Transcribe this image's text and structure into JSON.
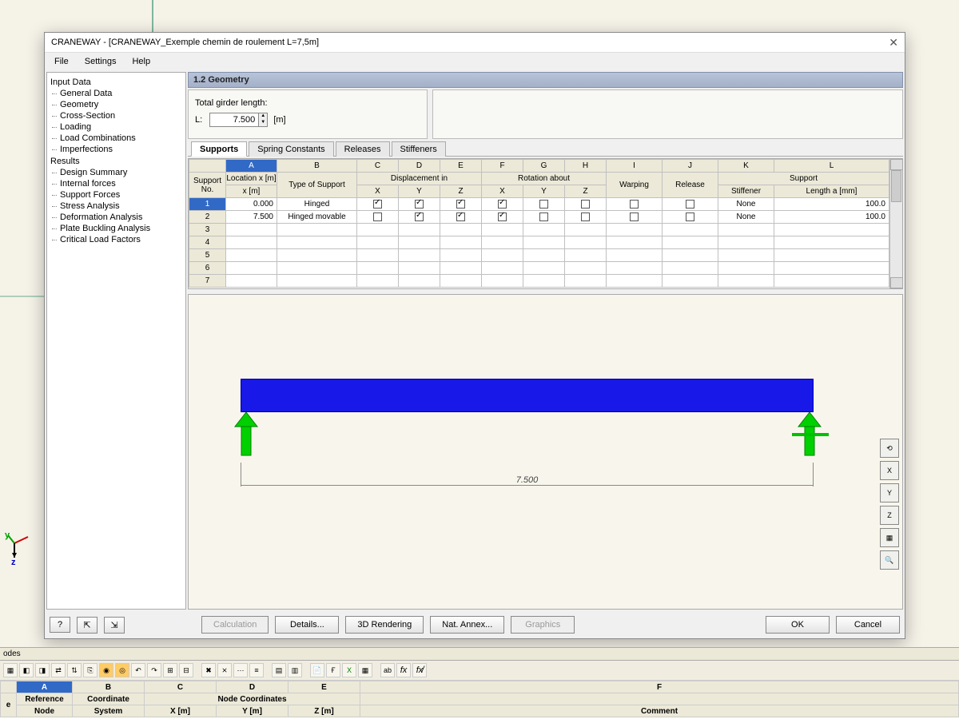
{
  "window": {
    "title": "CRANEWAY - [CRANEWAY_Exemple chemin de roulement L=7,5m]"
  },
  "menu": {
    "file": "File",
    "settings": "Settings",
    "help": "Help"
  },
  "tree": {
    "input": "Input Data",
    "input_items": [
      "General Data",
      "Geometry",
      "Cross-Section",
      "Loading",
      "Load Combinations",
      "Imperfections"
    ],
    "results": "Results",
    "results_items": [
      "Design Summary",
      "Internal forces",
      "Support Forces",
      "Stress Analysis",
      "Deformation Analysis",
      "Plate Buckling Analysis",
      "Critical Load Factors"
    ]
  },
  "section": {
    "title": "1.2 Geometry"
  },
  "params": {
    "girder_label": "Total girder length:",
    "L_label": "L:",
    "L_value": "7.500",
    "L_unit": "[m]"
  },
  "tabs": {
    "supports": "Supports",
    "spring": "Spring Constants",
    "releases": "Releases",
    "stiffeners": "Stiffeners"
  },
  "grid": {
    "letters": [
      "A",
      "B",
      "C",
      "D",
      "E",
      "F",
      "G",
      "H",
      "I",
      "J",
      "K",
      "L"
    ],
    "group1": "Support No.",
    "col_loc": "Location x [m]",
    "col_type": "Type of Support",
    "grp_disp": "Displacement in",
    "grp_rot": "Rotation about",
    "grp_support": "Support",
    "xyz": [
      "X",
      "Y",
      "Z"
    ],
    "warping": "Warping",
    "release": "Release",
    "stiffener": "Stiffener",
    "length": "Length a [mm]",
    "rows": [
      {
        "no": "1",
        "loc": "0.000",
        "type": "Hinged",
        "dx": true,
        "dy": true,
        "dz": true,
        "rx": true,
        "ry": false,
        "rz": false,
        "warp": false,
        "rel": false,
        "stiff": "None",
        "len": "100.0"
      },
      {
        "no": "2",
        "loc": "7.500",
        "type": "Hinged movable",
        "dx": false,
        "dy": true,
        "dz": true,
        "rx": true,
        "ry": false,
        "rz": false,
        "warp": false,
        "rel": false,
        "stiff": "None",
        "len": "100.0"
      }
    ],
    "empty_rows": [
      "3",
      "4",
      "5",
      "6",
      "7"
    ]
  },
  "preview": {
    "dim": "7.500"
  },
  "view_buttons": [
    "⟲",
    "X",
    "Y",
    "Z",
    "▦",
    "🔍"
  ],
  "buttons": {
    "help": "?",
    "b1": "⇱",
    "b2": "⇲",
    "calc": "Calculation",
    "details": "Details...",
    "render": "3D Rendering",
    "annex": "Nat. Annex...",
    "graphics": "Graphics",
    "ok": "OK",
    "cancel": "Cancel"
  },
  "bg_sheet": {
    "tab": "odes",
    "letters": [
      "A",
      "B",
      "C",
      "D",
      "E",
      "F"
    ],
    "h1": [
      "",
      "Reference",
      "Coordinate",
      "Node Coordinates",
      "",
      ""
    ],
    "h2": [
      "e",
      "Node",
      "System",
      "X [m]",
      "Y [m]",
      "Z [m]",
      "Comment"
    ]
  }
}
